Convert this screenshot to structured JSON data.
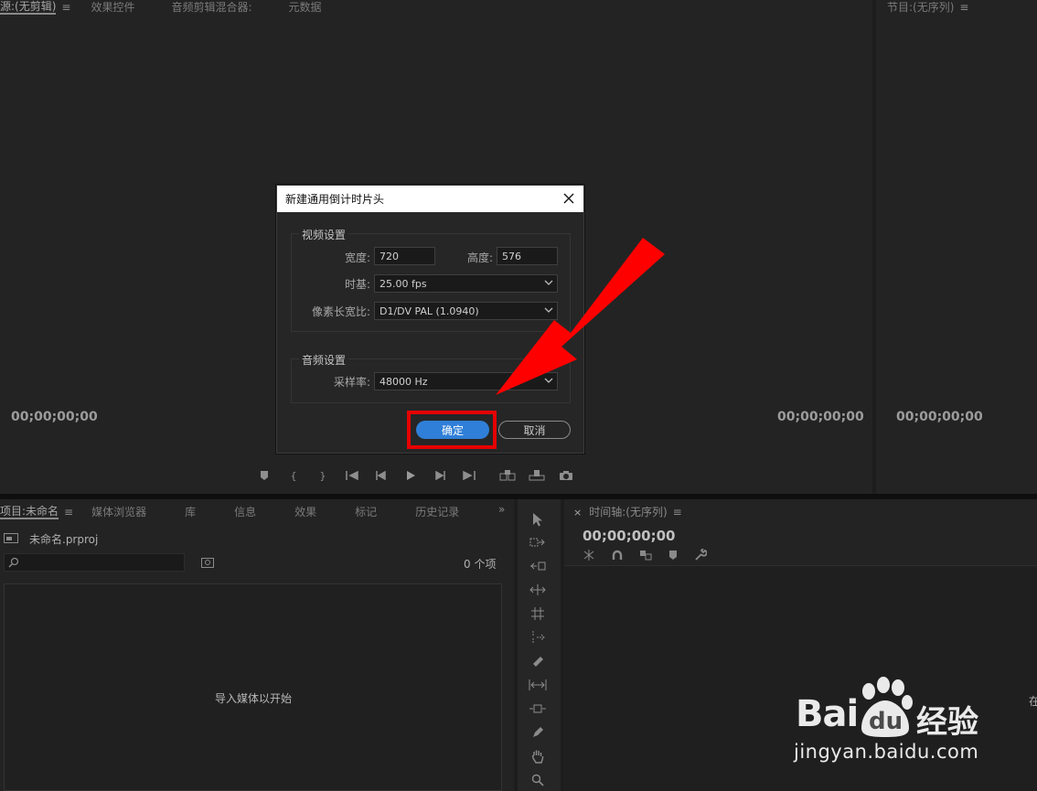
{
  "source_panel": {
    "tabs": [
      "源:(无剪辑)",
      "效果控件",
      "音频剪辑混合器:",
      "元数据"
    ],
    "timecode_left": "00;00;00;00",
    "timecode_right": "00;00;00;00"
  },
  "program_panel": {
    "tab": "节目:(无序列)",
    "timecode": "00;00;00;00"
  },
  "dialog": {
    "title": "新建通用倒计时片头",
    "video_group": "视频设置",
    "width_label": "宽度:",
    "width_value": "720",
    "height_label": "高度:",
    "height_value": "576",
    "timebase_label": "时基:",
    "timebase_value": "25.00 fps",
    "par_label": "像素长宽比:",
    "par_value": "D1/DV PAL (1.0940)",
    "audio_group": "音频设置",
    "samplerate_label": "采样率:",
    "samplerate_value": "48000 Hz",
    "ok_label": "确定",
    "cancel_label": "取消"
  },
  "project_panel": {
    "tabs": [
      "项目:未命名",
      "媒体浏览器",
      "库",
      "信息",
      "效果",
      "标记",
      "历史记录"
    ],
    "file_name": "未命名.prproj",
    "item_count": "0 个项",
    "empty_hint": "导入媒体以开始"
  },
  "timeline_panel": {
    "tab": "时间轴:(无序列)",
    "timecode": "00;00;00;00",
    "edge_text": "在"
  },
  "watermark": {
    "brand_a": "Bai",
    "brand_b": "du",
    "brand_cn": "经验",
    "url": "jingyan.baidu.com"
  },
  "colors": {
    "accent_blue": "#2f7fd8",
    "highlight_red": "#e60000",
    "arrow_red": "#ff0000"
  }
}
